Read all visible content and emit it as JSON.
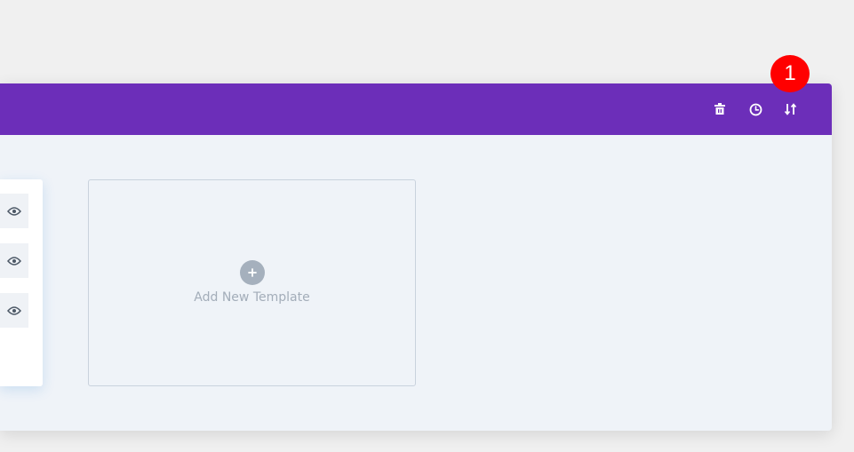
{
  "header": {
    "icons": [
      "trash-icon",
      "history-clock-icon",
      "sort-arrows-icon"
    ],
    "background_color": "#6c2eb9"
  },
  "annotation": {
    "badge_number": "1",
    "badge_color": "#ff0000"
  },
  "template_list": {
    "row_icons": [
      "eye-icon",
      "eye-icon",
      "eye-icon"
    ]
  },
  "add_template": {
    "label": "Add New Template",
    "icon": "plus-icon"
  }
}
